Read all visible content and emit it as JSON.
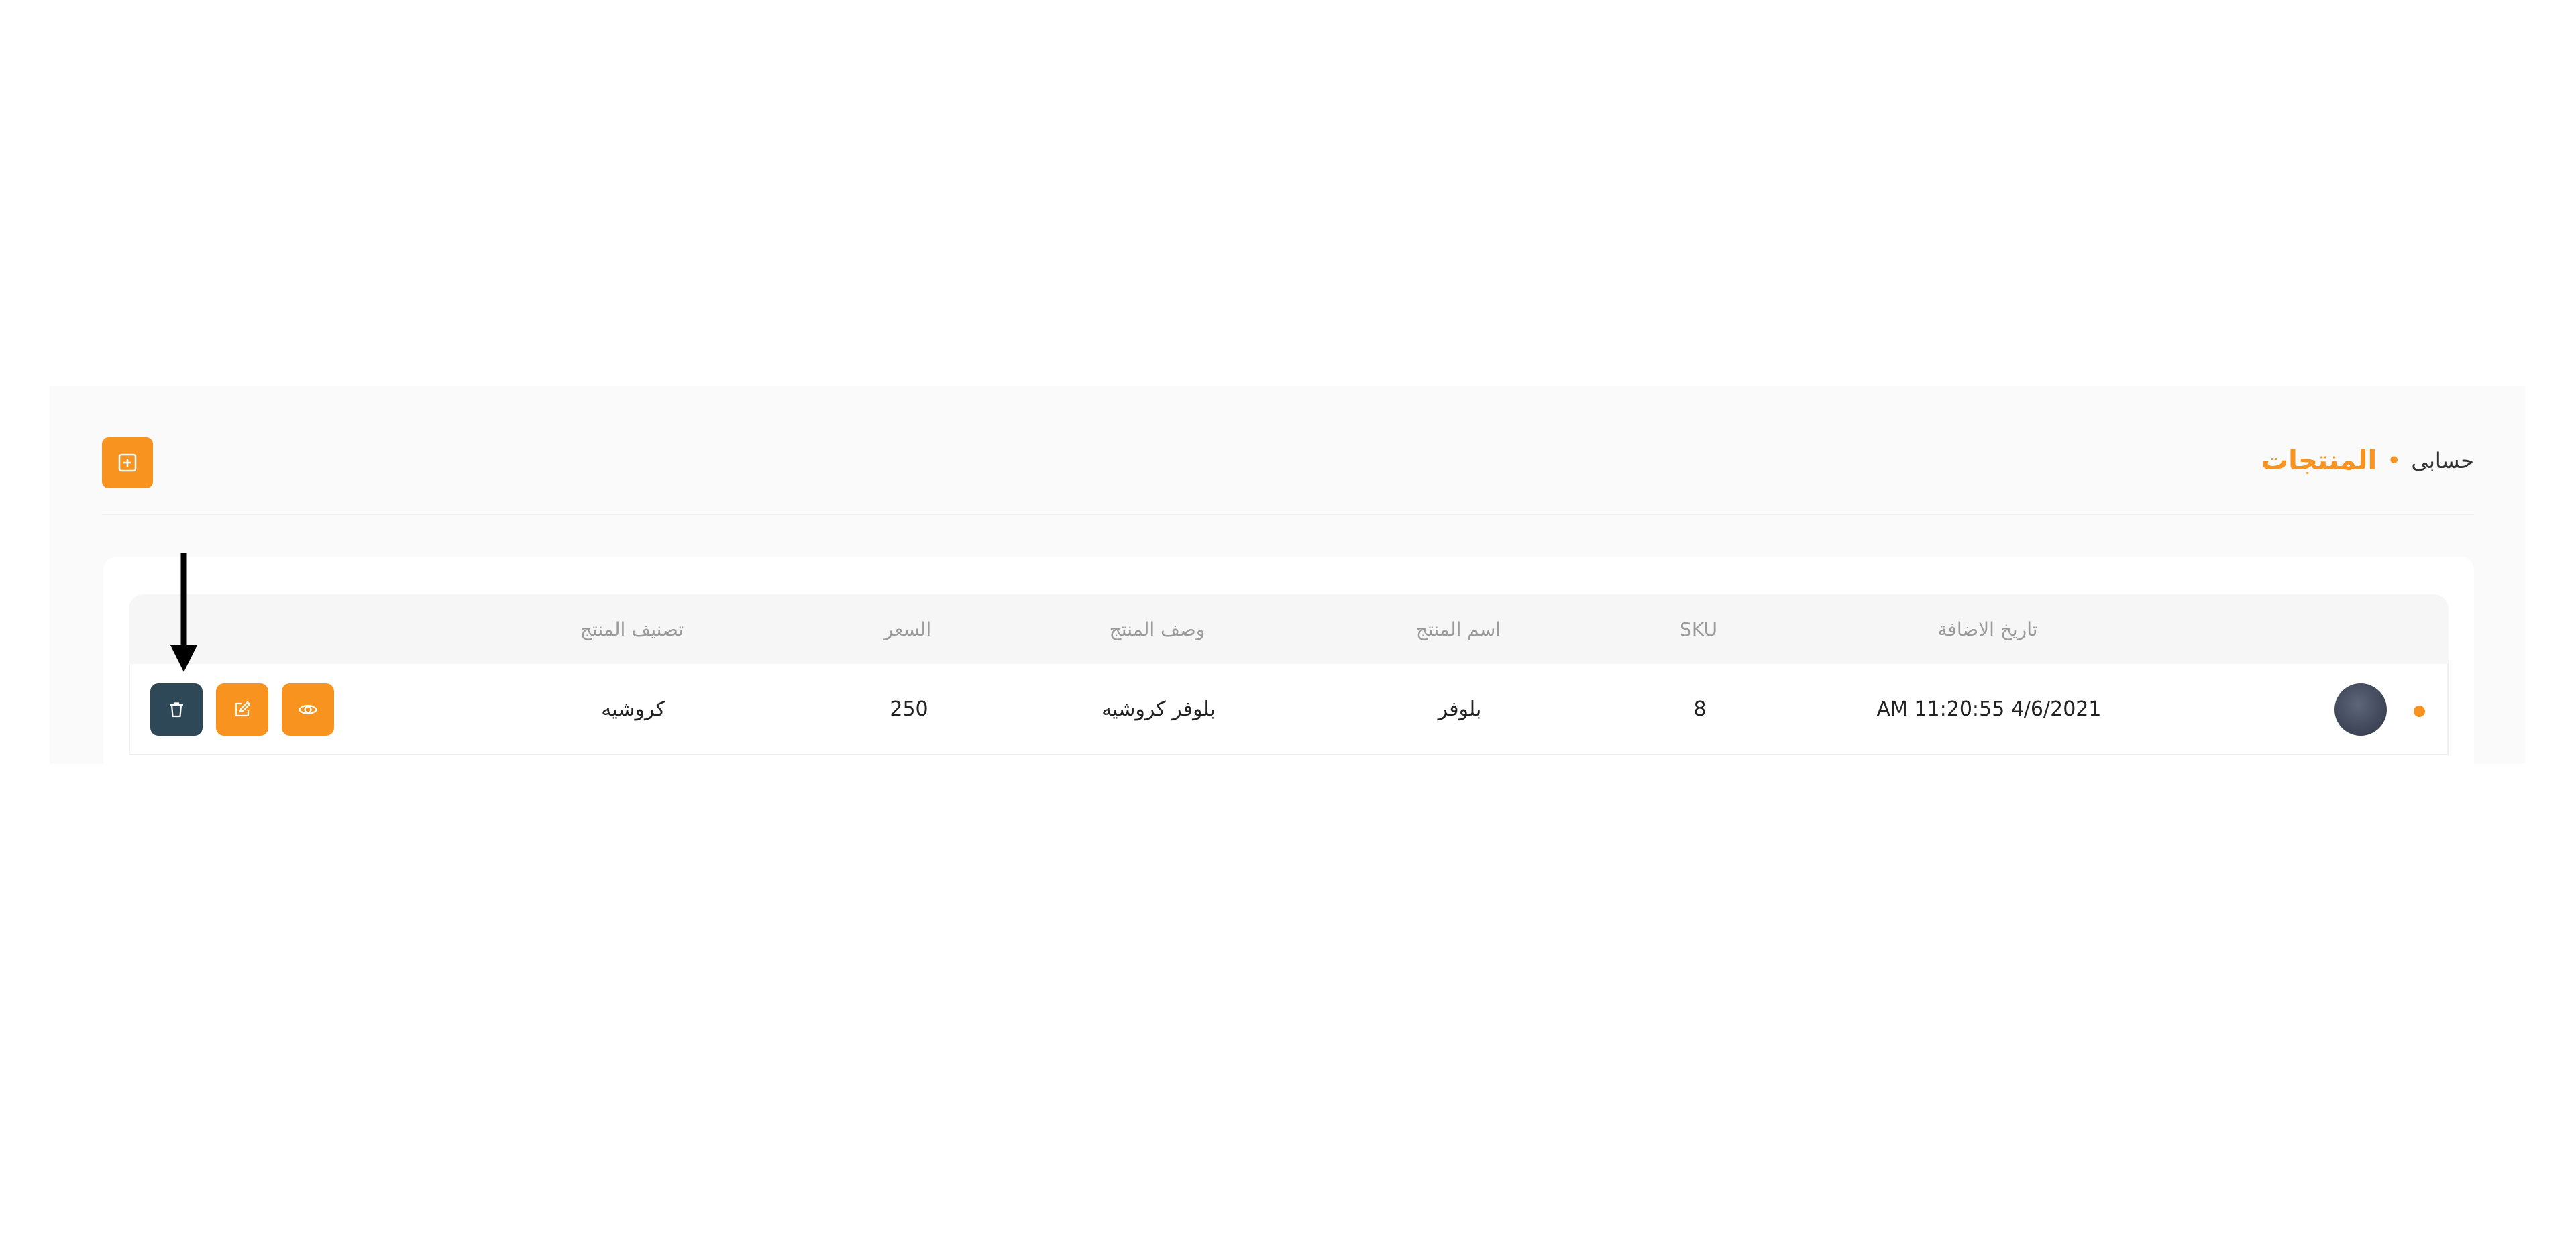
{
  "colors": {
    "accent": "#f7931e",
    "delete_button": "#2f4858",
    "panel_background": "#fafafa",
    "header_background": "#f6f6f6"
  },
  "breadcrumb": {
    "root": "حسابى",
    "separator": "•",
    "current": "المنتجات"
  },
  "toolbar": {
    "add_icon": "plus-square-icon"
  },
  "table": {
    "columns": {
      "date_added": "تاريخ الاضافة",
      "sku": "SKU",
      "name": "اسم المنتج",
      "description": "وصف المنتج",
      "price": "السعر",
      "category": "تصنيف المنتج"
    },
    "rows": [
      {
        "date_added": "AM 11:20:55 4/6/2021",
        "sku": "8",
        "name": "بلوفر",
        "description": "بلوفر كروشيه",
        "price": "250",
        "category": "كروشيه",
        "status_dot_icon": "status-dot-icon",
        "avatar": "product-thumbnail",
        "actions": [
          "view-icon",
          "edit-icon",
          "trash-icon"
        ]
      }
    ]
  },
  "annotation": {
    "arrow_icon": "down-arrow-icon"
  }
}
